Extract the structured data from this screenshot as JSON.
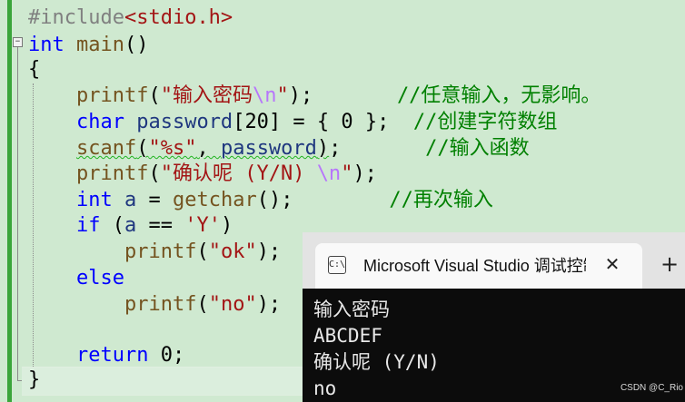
{
  "editor": {
    "lines": [
      {
        "parts": [
          [
            "pp",
            "#include"
          ],
          [
            "pp-hdr",
            "<stdio.h>"
          ]
        ]
      },
      {
        "parts": [
          [
            "kw",
            "int"
          ],
          [
            "",
            " "
          ],
          [
            "fn",
            "main"
          ],
          [
            "",
            "()"
          ]
        ]
      },
      {
        "parts": [
          [
            "",
            "{"
          ]
        ]
      },
      {
        "parts": [
          [
            "",
            "    "
          ],
          [
            "fn",
            "printf"
          ],
          [
            "",
            "("
          ],
          [
            "str",
            "\"输入密码"
          ],
          [
            "esc",
            "\\n"
          ],
          [
            "str",
            "\""
          ],
          [
            "",
            ");       "
          ],
          [
            "cm",
            "//任意输入，无影响。"
          ]
        ]
      },
      {
        "parts": [
          [
            "",
            "    "
          ],
          [
            "kw",
            "char"
          ],
          [
            "",
            " "
          ],
          [
            "id",
            "password"
          ],
          [
            "",
            "["
          ],
          [
            "num",
            "20"
          ],
          [
            "",
            "] = { "
          ],
          [
            "num",
            "0"
          ],
          [
            "",
            " };  "
          ],
          [
            "cm",
            "//创建字符数组"
          ]
        ]
      },
      {
        "parts": [
          [
            "",
            "    "
          ],
          [
            "fn squig",
            "scanf"
          ],
          [
            "squig",
            "("
          ],
          [
            "str squig",
            "\"%s\""
          ],
          [
            "squig",
            ", "
          ],
          [
            "id squig",
            "password"
          ],
          [
            "squig",
            ")"
          ],
          [
            "",
            ";       "
          ],
          [
            "cm",
            "//输入函数"
          ]
        ]
      },
      {
        "parts": [
          [
            "",
            "    "
          ],
          [
            "fn",
            "printf"
          ],
          [
            "",
            "("
          ],
          [
            "str",
            "\"确认呢 (Y/N) "
          ],
          [
            "esc",
            "\\n"
          ],
          [
            "str",
            "\""
          ],
          [
            "",
            ");"
          ]
        ]
      },
      {
        "parts": [
          [
            "",
            "    "
          ],
          [
            "kw",
            "int"
          ],
          [
            "",
            " "
          ],
          [
            "id",
            "a"
          ],
          [
            "",
            " = "
          ],
          [
            "fn",
            "getchar"
          ],
          [
            "",
            "();        "
          ],
          [
            "cm",
            "//再次输入"
          ]
        ]
      },
      {
        "parts": [
          [
            "",
            "    "
          ],
          [
            "kw",
            "if"
          ],
          [
            "",
            " ("
          ],
          [
            "id",
            "a"
          ],
          [
            "",
            " == "
          ],
          [
            "str",
            "'Y'"
          ],
          [
            "",
            ")"
          ]
        ]
      },
      {
        "parts": [
          [
            "",
            "        "
          ],
          [
            "fn",
            "printf"
          ],
          [
            "",
            "("
          ],
          [
            "str",
            "\"ok\""
          ],
          [
            "",
            ");"
          ]
        ]
      },
      {
        "parts": [
          [
            "",
            "    "
          ],
          [
            "kw",
            "else"
          ]
        ]
      },
      {
        "parts": [
          [
            "",
            "        "
          ],
          [
            "fn",
            "printf"
          ],
          [
            "",
            "("
          ],
          [
            "str",
            "\"no\""
          ],
          [
            "",
            ");"
          ]
        ]
      },
      {
        "parts": [
          [
            "",
            ""
          ]
        ]
      },
      {
        "parts": [
          [
            "",
            "    "
          ],
          [
            "kw",
            "return"
          ],
          [
            "",
            " "
          ],
          [
            "num",
            "0"
          ],
          [
            "",
            ";"
          ]
        ]
      },
      {
        "parts": [
          [
            "",
            "}"
          ]
        ]
      }
    ]
  },
  "console": {
    "tab_title": "Microsoft Visual Studio 调试控制台",
    "icon_glyph": "C:\\",
    "close_glyph": "✕",
    "new_tab_glyph": "+",
    "output": [
      "输入密码",
      "ABCDEF",
      "确认呢 (Y/N)",
      "no"
    ]
  },
  "watermark": "CSDN @C_Rio"
}
